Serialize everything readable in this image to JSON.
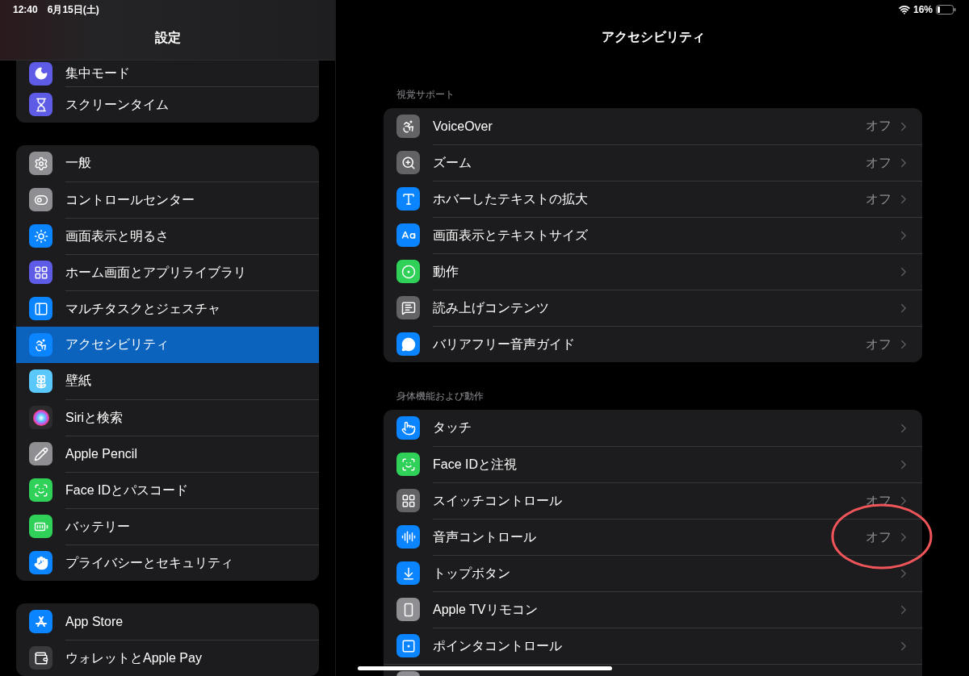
{
  "status_bar": {
    "time": "12:40",
    "date": "6月15日(土)",
    "battery": "16%"
  },
  "sidebar": {
    "title": "設定",
    "groups": [
      {
        "items": [
          {
            "label": "集中モード",
            "selected": false
          },
          {
            "label": "スクリーンタイム",
            "selected": false
          }
        ]
      },
      {
        "items": [
          {
            "label": "一般",
            "selected": false
          },
          {
            "label": "コントロールセンター",
            "selected": false
          },
          {
            "label": "画面表示と明るさ",
            "selected": false
          },
          {
            "label": "ホーム画面とアプリライブラリ",
            "selected": false
          },
          {
            "label": "マルチタスクとジェスチャ",
            "selected": false
          },
          {
            "label": "アクセシビリティ",
            "selected": true
          },
          {
            "label": "壁紙",
            "selected": false
          },
          {
            "label": "Siriと検索",
            "selected": false
          },
          {
            "label": "Apple Pencil",
            "selected": false
          },
          {
            "label": "Face IDとパスコード",
            "selected": false
          },
          {
            "label": "バッテリー",
            "selected": false
          },
          {
            "label": "プライバシーとセキュリティ",
            "selected": false
          }
        ]
      },
      {
        "items": [
          {
            "label": "App Store",
            "selected": false
          },
          {
            "label": "ウォレットとApple Pay",
            "selected": false
          }
        ]
      }
    ]
  },
  "detail": {
    "title": "アクセシビリティ",
    "sections": [
      {
        "header": "視覚サポート",
        "rows": [
          {
            "label": "VoiceOver",
            "value": "オフ"
          },
          {
            "label": "ズーム",
            "value": "オフ"
          },
          {
            "label": "ホバーしたテキストの拡大",
            "value": "オフ"
          },
          {
            "label": "画面表示とテキストサイズ"
          },
          {
            "label": "動作"
          },
          {
            "label": "読み上げコンテンツ"
          },
          {
            "label": "バリアフリー音声ガイド",
            "value": "オフ"
          }
        ]
      },
      {
        "header": "身体機能および動作",
        "rows": [
          {
            "label": "タッチ"
          },
          {
            "label": "Face IDと注視"
          },
          {
            "label": "スイッチコントロール",
            "value": "オフ"
          },
          {
            "label": "音声コントロール",
            "value": "オフ"
          },
          {
            "label": "トップボタン"
          },
          {
            "label": "Apple TVリモコン"
          },
          {
            "label": "ポインタコントロール"
          }
        ]
      }
    ]
  }
}
